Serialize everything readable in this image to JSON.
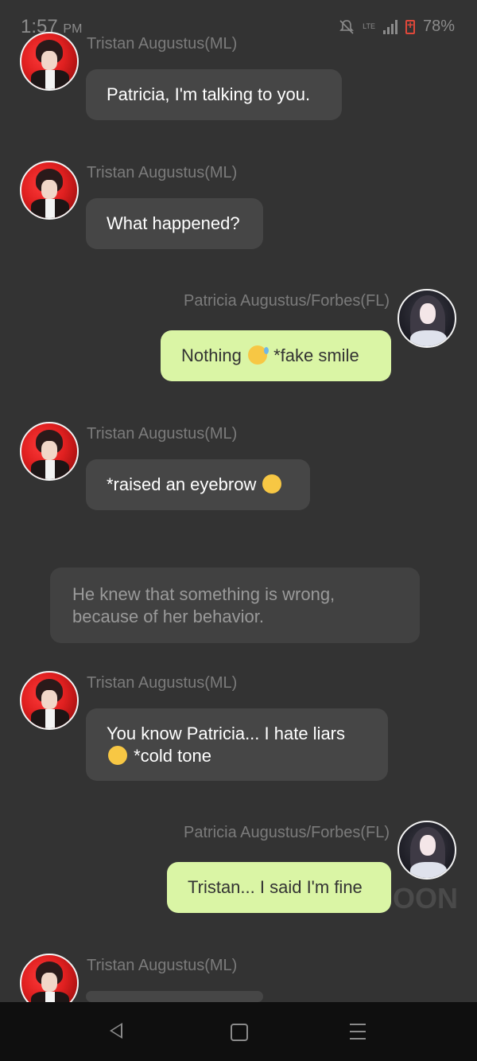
{
  "status_bar": {
    "time": "1:57",
    "ampm": "PM",
    "network": "LTE",
    "battery": "78%"
  },
  "characters": {
    "tristan": "Tristan Augustus(ML)",
    "patricia": "Patricia Augustus/Forbes(FL)"
  },
  "messages": [
    {
      "speaker": "Tristan Augustus(ML)",
      "text": "Patricia, I'm talking to you."
    },
    {
      "speaker": "Tristan Augustus(ML)",
      "text": "What happened?"
    },
    {
      "speaker": "Patricia Augustus/Forbes(FL)",
      "text_before": "Nothing",
      "emoji": "grinning-sweat-emoji",
      "text_after": "*fake smile"
    },
    {
      "speaker": "Tristan Augustus(ML)",
      "text": "*raised an eyebrow",
      "emoji": "raised-eyebrow-emoji"
    },
    {
      "narration": "He knew that something is wrong, because of her behavior."
    },
    {
      "speaker": "Tristan Augustus(ML)",
      "line1": "You know Patricia... I hate liars",
      "emoji": "angry-face-emoji",
      "line2": "*cold tone"
    },
    {
      "speaker": "Patricia Augustus/Forbes(FL)",
      "text": "Tristan... I said I'm fine"
    },
    {
      "speaker": "Tristan Augustus(ML)"
    }
  ],
  "watermark": "OON",
  "colors": {
    "background": "#333333",
    "incoming_bubble": "#464646",
    "outgoing_bubble": "#daf5a5",
    "narration_bubble": "#414141",
    "battery": "#e0483a"
  }
}
